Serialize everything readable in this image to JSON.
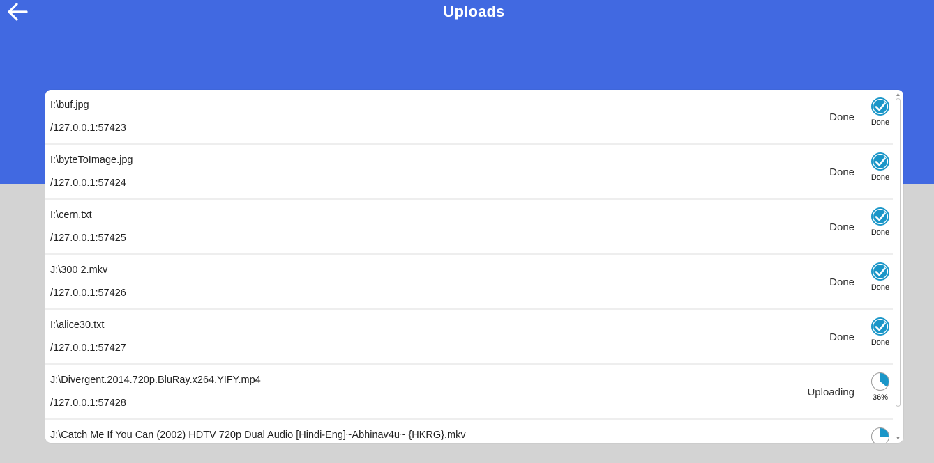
{
  "header": {
    "title": "Uploads",
    "back_icon": "arrow-left-icon",
    "color": "#4169e1"
  },
  "uploads": [
    {
      "path": "I:\\buf.jpg",
      "address": "/127.0.0.1:57423",
      "status": "Done",
      "indicator": "Done",
      "progress": 1.0
    },
    {
      "path": "I:\\byteToImage.jpg",
      "address": "/127.0.0.1:57424",
      "status": "Done",
      "indicator": "Done",
      "progress": 1.0
    },
    {
      "path": "I:\\cern.txt",
      "address": "/127.0.0.1:57425",
      "status": "Done",
      "indicator": "Done",
      "progress": 1.0
    },
    {
      "path": "J:\\300 2.mkv",
      "address": "/127.0.0.1:57426",
      "status": "Done",
      "indicator": "Done",
      "progress": 1.0
    },
    {
      "path": "I:\\alice30.txt",
      "address": "/127.0.0.1:57427",
      "status": "Done",
      "indicator": "Done",
      "progress": 1.0
    },
    {
      "path": "J:\\Divergent.2014.720p.BluRay.x264.YIFY.mp4",
      "address": "/127.0.0.1:57428",
      "status": "Uploading",
      "indicator": "36%",
      "progress": 0.36
    },
    {
      "path": "J:\\Catch Me If You Can (2002) HDTV 720p Dual Audio [Hindi-Eng]~Abhinav4u~ {HKRG}.mkv",
      "address": "",
      "status": "",
      "indicator": "",
      "progress": 0.25
    }
  ],
  "colors": {
    "done_icon": "#1a96c8",
    "progress_fill": "#1a96c8",
    "progress_ring": "#999999"
  }
}
